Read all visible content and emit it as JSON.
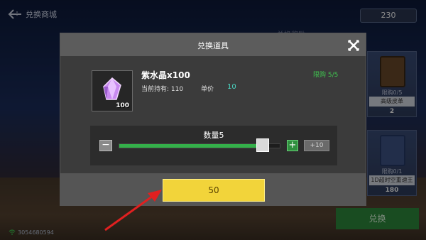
{
  "header": {
    "back_label": "兑换商城",
    "currency_amount": "230",
    "bg_hint": "兑换奖励"
  },
  "side_items": [
    {
      "limit": "限购0/5",
      "name": "高级皮革",
      "price": "2"
    },
    {
      "limit": "限购0/1",
      "name": "1D超时空重速王",
      "price": "180"
    }
  ],
  "background_exchange_button": "兑换",
  "uid": "3054680594",
  "modal": {
    "title": "兑换道具",
    "item": {
      "name": "紫水晶x100",
      "icon_qty": "100",
      "owned_label": "当前持有: 110",
      "price_label": "单价",
      "price_value": "10",
      "limit_label": "限购 5/5"
    },
    "quantity": {
      "title": "数量5",
      "level": 0.89,
      "plus10_label": "+10"
    },
    "confirm_label": "50"
  },
  "colors": {
    "accent_green": "#34b04a",
    "confirm_yellow": "#f2d43a",
    "price_teal": "#4ad6c2"
  },
  "icons": [
    "back-arrow-icon",
    "close-icon",
    "crystal-icon",
    "minus-icon",
    "plus-icon",
    "wifi-icon",
    "pointer-arrow-icon"
  ]
}
